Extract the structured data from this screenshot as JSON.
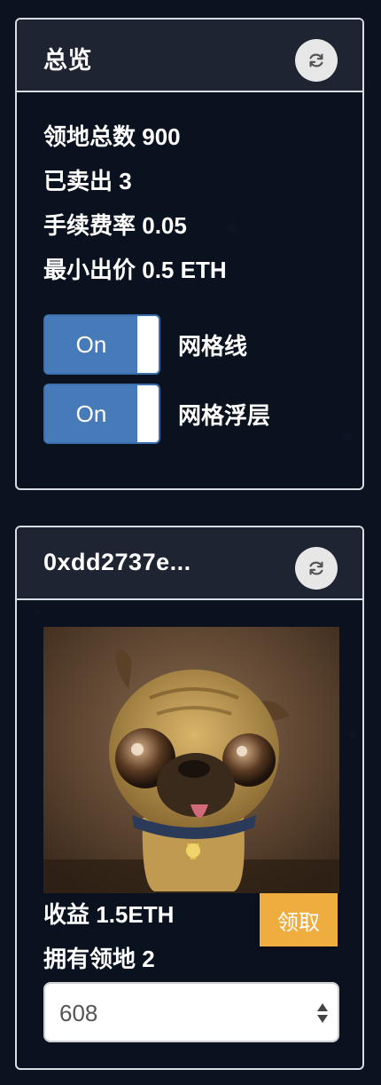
{
  "overview": {
    "title": "总览",
    "refresh_icon": "refresh-icon",
    "stats": [
      {
        "label": "领地总数",
        "value": "900"
      },
      {
        "label": "已卖出",
        "value": "3"
      },
      {
        "label": "手续费率",
        "value": "0.05"
      },
      {
        "label": "最小出价",
        "value": "0.5 ETH"
      }
    ],
    "toggles": [
      {
        "state": "On",
        "label": "网格线"
      },
      {
        "state": "On",
        "label": "网格浮层"
      }
    ]
  },
  "account": {
    "address": "0xdd2737e...",
    "refresh_icon": "refresh-icon",
    "avatar_icon": "pug-avatar-image",
    "earnings_label": "收益",
    "earnings_value": "1.5ETH",
    "claim_label": "领取",
    "owned_label": "拥有领地",
    "owned_value": "2",
    "selected_land": "608"
  },
  "colors": {
    "background": "#0c1220",
    "panel_header": "#1e2431",
    "toggle_on": "#467ab8",
    "claim_button": "#f0ad3f"
  }
}
